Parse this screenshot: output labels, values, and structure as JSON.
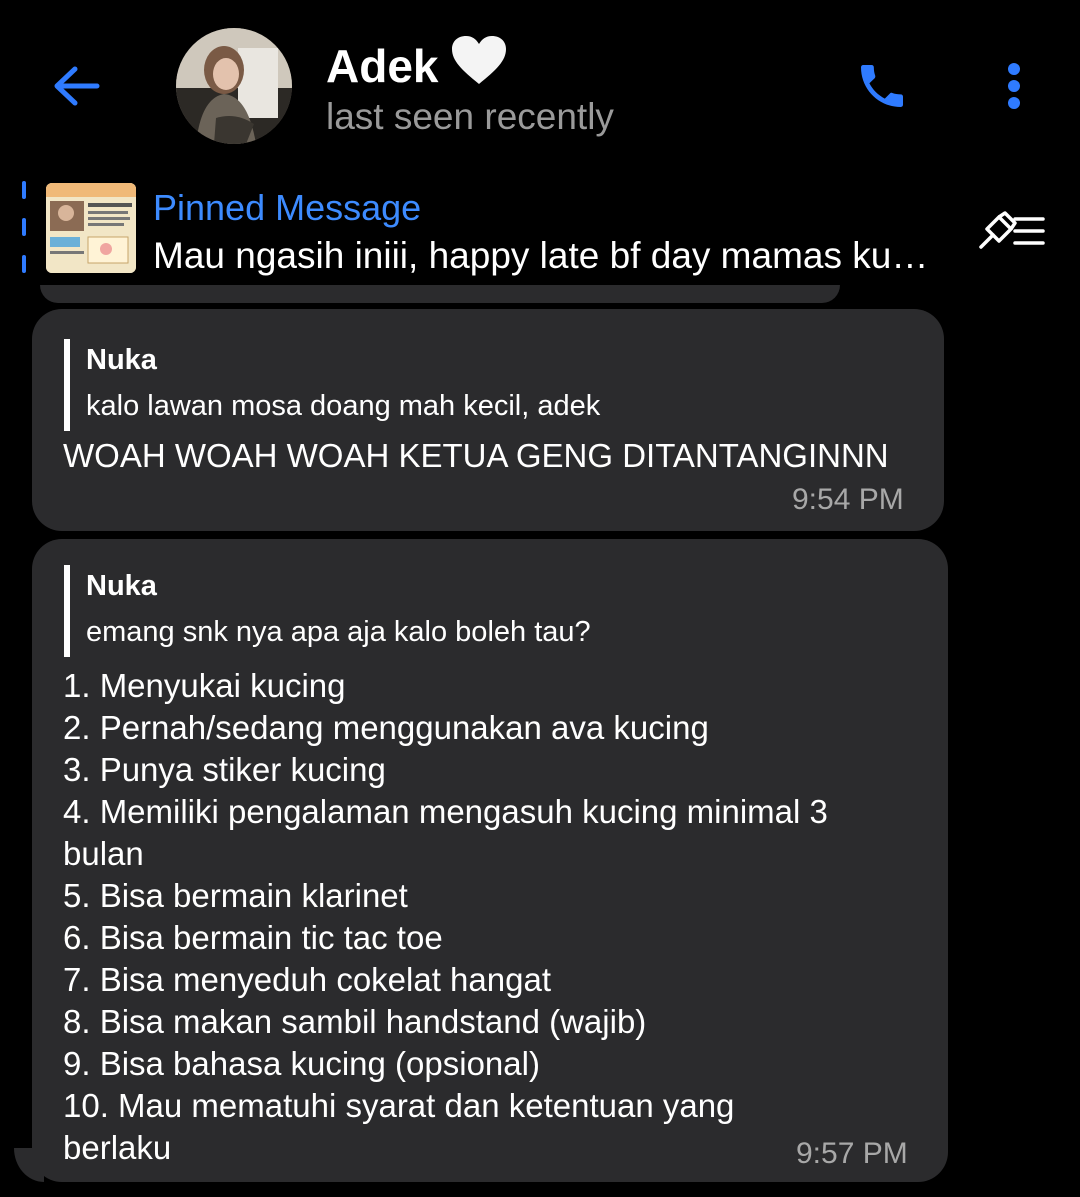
{
  "header": {
    "contact_name": "Adek",
    "status": "last seen recently"
  },
  "colors": {
    "accent": "#2f7bff",
    "pinned_title": "#3d8bff",
    "bubble": "#2b2b2d",
    "background": "#000000",
    "secondary_text": "#9a9a9a"
  },
  "icons": {
    "back": "arrow-left-icon",
    "heart": "white-heart-icon",
    "call": "phone-icon",
    "more": "vertical-dots-icon",
    "pin_list": "pin-list-icon"
  },
  "pinned": {
    "title": "Pinned Message",
    "text": "Mau ngasih iniii, happy late bf day mamas ku…"
  },
  "messages": [
    {
      "reply": {
        "name": "Nuka",
        "text": "kalo lawan mosa doang mah kecil, adek"
      },
      "text": "WOAH WOAH WOAH KETUA GENG DITANTANGINNN",
      "time": "9:54 PM"
    },
    {
      "reply": {
        "name": "Nuka",
        "text": "emang snk nya apa aja kalo boleh tau?"
      },
      "lines": [
        "1. Menyukai kucing",
        "2. Pernah/sedang menggunakan ava kucing",
        "3. Punya stiker kucing",
        "4. Memiliki pengalaman mengasuh kucing minimal 3",
        "bulan",
        "5. Bisa bermain klarinet",
        "6. Bisa bermain tic tac toe",
        "7. Bisa menyeduh cokelat hangat",
        "8. Bisa makan sambil handstand (wajib)",
        "9. Bisa bahasa kucing (opsional)",
        "10. Mau mematuhi syarat dan ketentuan yang",
        "berlaku"
      ],
      "time": "9:57 PM"
    }
  ]
}
